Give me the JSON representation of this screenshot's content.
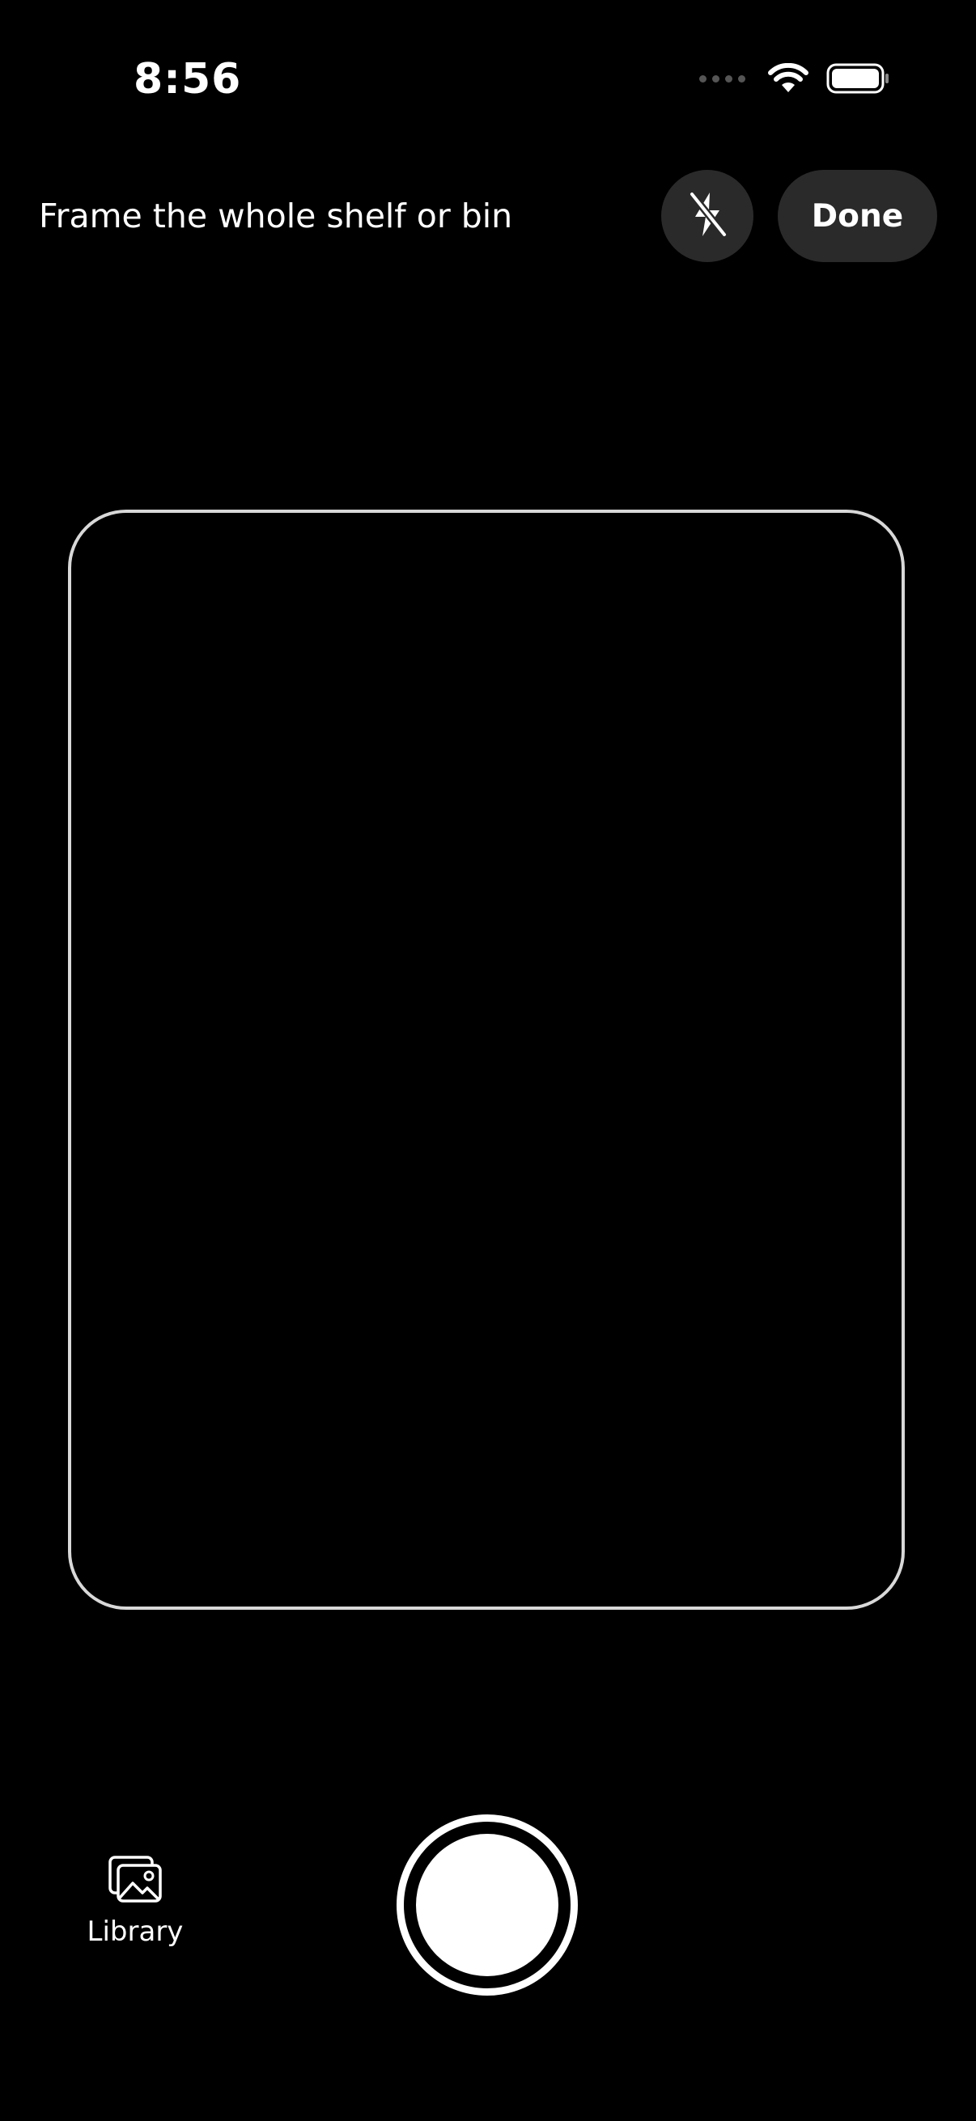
{
  "status_bar": {
    "time": "8:56",
    "signal_icon": "cellular-dots-icon",
    "wifi_icon": "wifi-icon",
    "battery_icon": "battery-icon"
  },
  "header": {
    "instruction": "Frame the whole shelf or bin",
    "flash_icon": "flash-off-icon",
    "done_label": "Done"
  },
  "viewfinder": {
    "frame_color": "#d8d8d8"
  },
  "controls": {
    "library_icon": "photo-library-icon",
    "library_label": "Library",
    "shutter_icon": "shutter-button"
  },
  "colors": {
    "background": "#000000",
    "button_bg": "#2a2a2a",
    "text": "#ffffff"
  }
}
